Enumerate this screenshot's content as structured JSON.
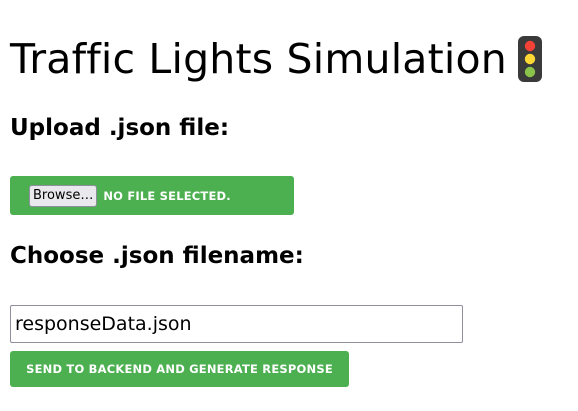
{
  "page": {
    "title": "Traffic Lights Simulation",
    "title_icon": "traffic-light-icon"
  },
  "upload": {
    "label": "Upload .json file:",
    "browse_label": "Browse…",
    "status_text": "NO FILE SELECTED."
  },
  "filename": {
    "label": "Choose .json filename:",
    "value": "responseData.json"
  },
  "submit": {
    "label": "SEND TO BACKEND AND GENERATE RESPONSE"
  },
  "colors": {
    "accent": "#4caf50",
    "traffic_red": "#f44336",
    "traffic_yellow": "#fdd835",
    "traffic_green": "#8bc34a",
    "traffic_body": "#3a3a3a"
  }
}
